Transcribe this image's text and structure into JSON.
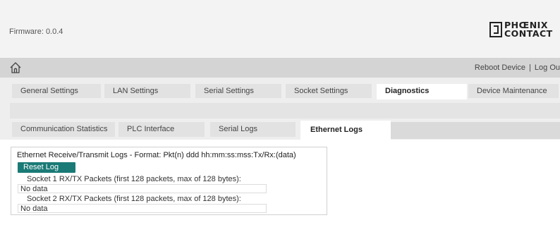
{
  "header": {
    "firmware": "Firmware: 0.0.4",
    "brand_line1": "PHŒNIX",
    "brand_line2": "CONTACT"
  },
  "nav": {
    "home_icon": "home-icon",
    "reboot_label": "Reboot Device",
    "separator": "|",
    "logout_label": "Log Ou"
  },
  "main_tabs": [
    {
      "label": "General Settings",
      "active": false
    },
    {
      "label": "LAN Settings",
      "active": false
    },
    {
      "label": "Serial Settings",
      "active": false
    },
    {
      "label": "Socket Settings",
      "active": false
    },
    {
      "label": "Diagnostics",
      "active": true
    },
    {
      "label": "Device Maintenance",
      "active": false
    }
  ],
  "sub_tabs": [
    {
      "label": "Communication Statistics",
      "active": false
    },
    {
      "label": "PLC Interface",
      "active": false
    },
    {
      "label": "Serial Logs",
      "active": false
    },
    {
      "label": "Ethernet Logs",
      "active": true
    }
  ],
  "logs": {
    "title": "Ethernet Receive/Transmit Logs - Format: Pkt(n) ddd hh:mm:ss:mss:Tx/Rx:(data)",
    "reset_label": "Reset Log",
    "sockets": [
      {
        "title": "Socket 1 RX/TX Packets (first 128 packets, max of 128 bytes):",
        "data": "No data"
      },
      {
        "title": "Socket 2 RX/TX Packets (first 128 packets, max of 128 bytes):",
        "data": "No data"
      }
    ]
  },
  "colors": {
    "header_bg": "#f3f3f3",
    "navbar_bg": "#d4d4d4",
    "button_accent": "#1a7a76"
  }
}
